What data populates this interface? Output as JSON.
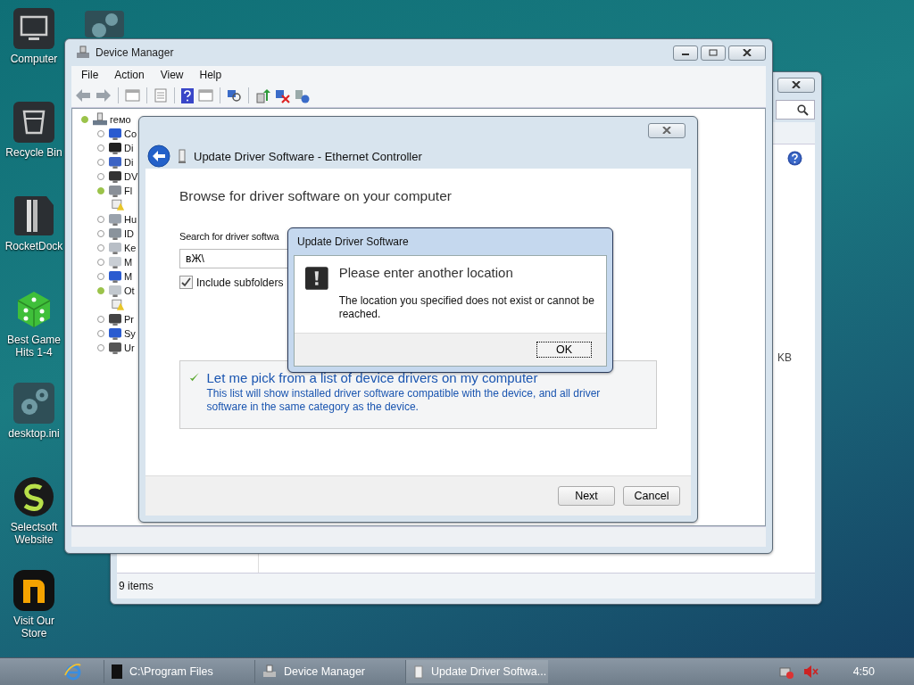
{
  "desktop_icons": [
    {
      "label": "Computer",
      "kind": "computer"
    },
    {
      "label": "Recycle Bin",
      "kind": "bin"
    },
    {
      "label": "RocketDock",
      "kind": "dock"
    },
    {
      "label": "Best Game Hits 1-4",
      "kind": "dice"
    },
    {
      "label": "desktop.ini",
      "kind": "gears"
    },
    {
      "label": "Selectsoft Website",
      "kind": "selectsoft"
    },
    {
      "label": "Visit Our Store",
      "kind": "store"
    }
  ],
  "explorer_window": {
    "size_text": "KB",
    "status": "9 items"
  },
  "device_manager": {
    "title": "Device Manager",
    "menu": [
      "File",
      "Action",
      "View",
      "Help"
    ],
    "tree": {
      "label": "гемо",
      "kind": "computer",
      "expanded": true,
      "children": [
        {
          "label": "Co",
          "kind": "monitor",
          "expanded": false
        },
        {
          "label": "Di",
          "kind": "disk",
          "expanded": false
        },
        {
          "label": "Di",
          "kind": "display",
          "expanded": false
        },
        {
          "label": "DV",
          "kind": "dvd",
          "expanded": false
        },
        {
          "label": "Fl",
          "kind": "floppy",
          "expanded": true,
          "children": [
            {
              "kind": "warning"
            }
          ]
        },
        {
          "label": "Hu",
          "kind": "hid",
          "expanded": false
        },
        {
          "label": "ID",
          "kind": "ide",
          "expanded": false
        },
        {
          "label": "Ke",
          "kind": "keyboard",
          "expanded": false
        },
        {
          "label": "M",
          "kind": "mouse",
          "expanded": false
        },
        {
          "label": "M",
          "kind": "monitor",
          "expanded": false
        },
        {
          "label": "Ot",
          "kind": "other",
          "expanded": true,
          "children": [
            {
              "kind": "warning"
            }
          ]
        },
        {
          "label": "Pr",
          "kind": "chip",
          "expanded": false
        },
        {
          "label": "Sy",
          "kind": "monitor",
          "expanded": false
        },
        {
          "label": "Ur",
          "kind": "usb",
          "expanded": false
        }
      ]
    }
  },
  "wizard": {
    "title": "Update Driver Software - Ethernet Controller",
    "heading": "Browse for driver software on your computer",
    "search_label": "Search for driver softwa",
    "path_value": "вЖ\\",
    "include_subfolders": {
      "label": "Include subfolders",
      "checked": true
    },
    "option": {
      "title": "Let me pick from a list of device drivers on my computer",
      "description": "This list will show installed driver software compatible with the device, and all driver software in the same category as the device."
    },
    "buttons": [
      "Next",
      "Cancel"
    ]
  },
  "message_box": {
    "title": "Update Driver Software",
    "heading": "Please enter another location",
    "text": "The location you specified does not exist or cannot be reached.",
    "button": "OK"
  },
  "taskbar": {
    "tasks": [
      {
        "label": "C:\\Program Files",
        "kind": "console",
        "selected": false
      },
      {
        "label": "Device Manager",
        "kind": "devmgr",
        "selected": false
      },
      {
        "label": "Update Driver Softwa...",
        "kind": "driver",
        "selected": true
      }
    ],
    "clock": "4:50"
  }
}
